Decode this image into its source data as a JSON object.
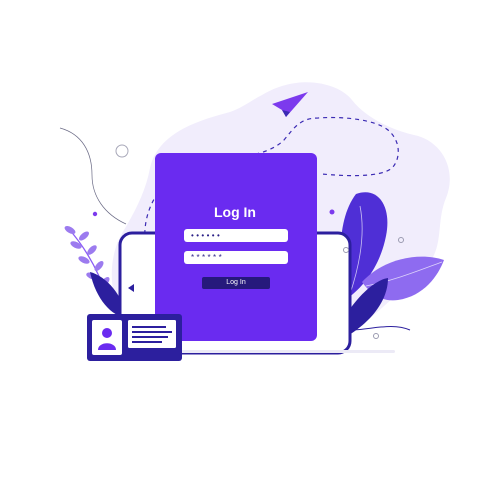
{
  "login_panel": {
    "title": "Log In",
    "username_value": "••••••",
    "password_value": "******",
    "button_label": "Log In"
  },
  "colors": {
    "accent": "#6A2BF0",
    "deep_indigo": "#2C1F9E",
    "lavender_blob": "#F1EDFC",
    "leaf_light": "#9C7BEF"
  }
}
